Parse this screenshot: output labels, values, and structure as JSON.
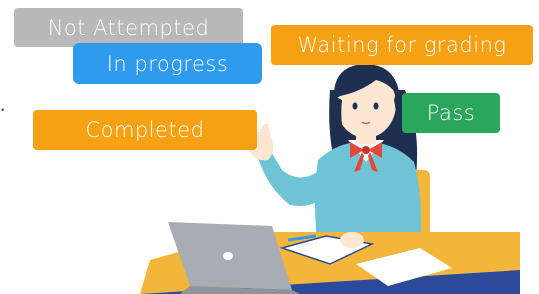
{
  "badges": {
    "not_attempted": {
      "label": "Not Attempted",
      "color": "#b9b9b9"
    },
    "in_progress": {
      "label": "In progress",
      "color": "#2f9bef"
    },
    "waiting_for_grading": {
      "label": "Waiting for grading",
      "color": "#f6a014"
    },
    "completed": {
      "label": "Completed",
      "color": "#f6a014"
    },
    "pass": {
      "label": "Pass",
      "color": "#2aa75c"
    }
  },
  "illustration": {
    "subject": "student-studying-at-laptop",
    "colors": {
      "hair": "#1e2f4f",
      "skin": "#fde7d2",
      "blazer": "#6fc3d6",
      "bow": "#e5473a",
      "desk": "#f3b63a",
      "desk_front": "#2d4a9a",
      "laptop": "#a8acb3",
      "notebook": "#ffffff"
    }
  }
}
